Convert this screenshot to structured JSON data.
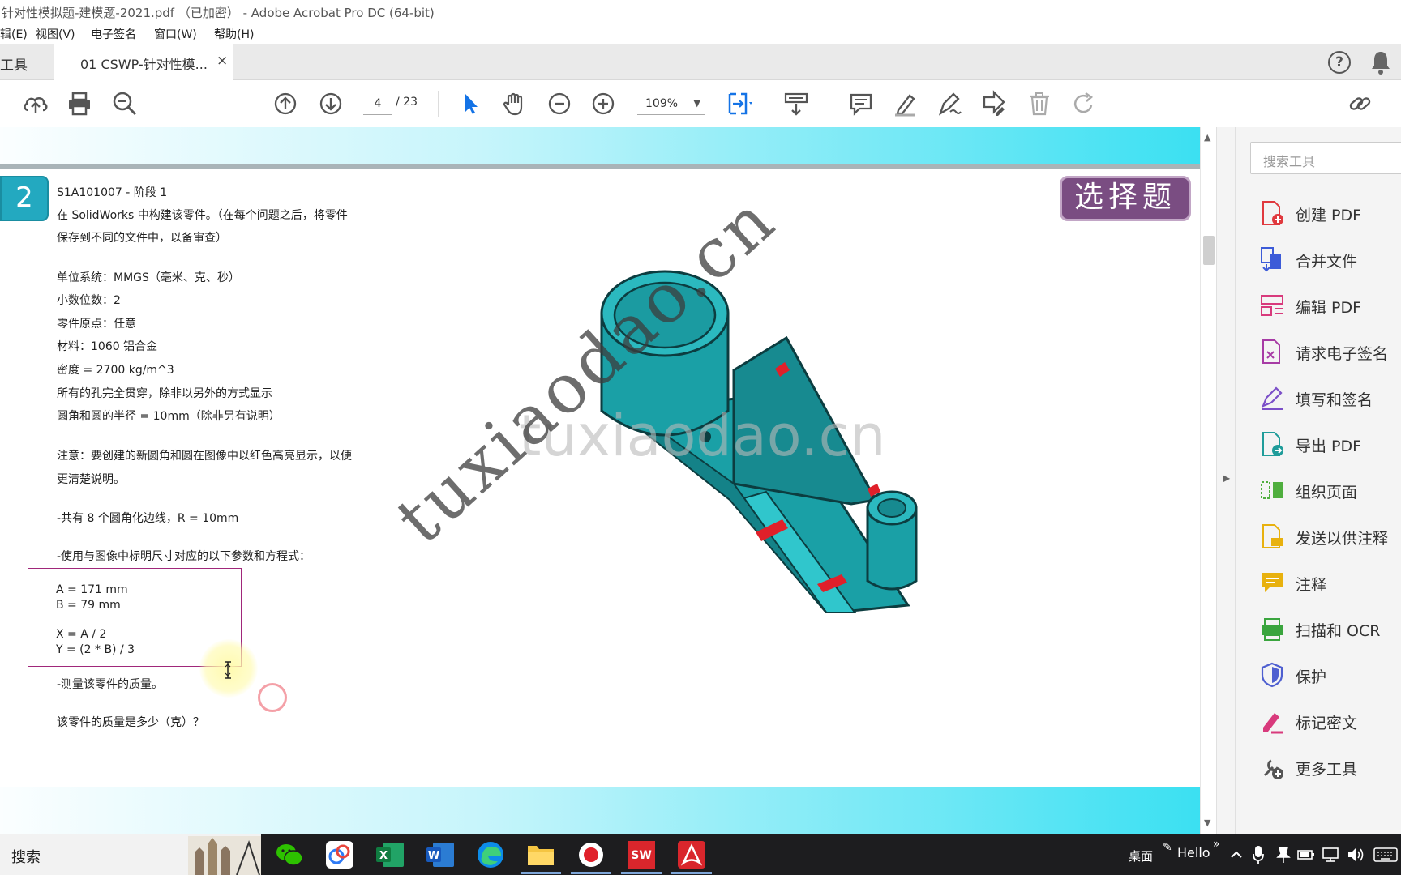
{
  "window": {
    "title": "针对性模拟题-建模题-2021.pdf （已加密） - Adobe Acrobat Pro DC (64-bit)"
  },
  "menu": [
    {
      "id": "edit",
      "label": "辑(E)"
    },
    {
      "id": "view",
      "label": "视图(V)"
    },
    {
      "id": "esign",
      "label": "电子签名"
    },
    {
      "id": "window",
      "label": "窗口(W)"
    },
    {
      "id": "help",
      "label": "帮助(H)"
    }
  ],
  "tabs": {
    "tools": "工具",
    "document": "01 CSWP-针对性模...",
    "close": "×",
    "help": "?"
  },
  "toolbar": {
    "page_current": "4",
    "page_total": "/ 23",
    "zoom": "109%"
  },
  "document": {
    "question_number": "2",
    "badge": "选择题",
    "lines": {
      "id": "S1A101007 - 阶段 1",
      "intro1": "在 SolidWorks 中构建该零件。（在每个问题之后，将零件",
      "intro2": "保存到不同的文件中，以备审查）",
      "units": "单位系统：MMGS（毫米、克、秒）",
      "decimals": "小数位数：2",
      "origin": "零件原点：任意",
      "material": "材料：1060 铝合金",
      "density": "密度 = 2700 kg/m^3",
      "holes": "所有的孔完全贯穿，除非以另外的方式显示",
      "fillets": "圆角和圆的半径 = 10mm（除非另有说明）",
      "note1": "注意：要创建的新圆角和圆在图像中以红色高亮显示，以便",
      "note2": "更清楚说明。",
      "edges": "-共有 8 个圆角化边线，R = 10mm",
      "params_intro": "-使用与图像中标明尺寸对应的以下参数和方程式：",
      "measure": "-测量该零件的质量。",
      "question": "该零件的质量是多少（克）？"
    },
    "params": {
      "a": "A = 171 mm",
      "b": "B = 79 mm",
      "x": "X = A / 2",
      "y": "Y = (2 * B) / 3"
    },
    "watermark_horizontal": "tuxiaodao.cn",
    "watermark_diagonal": "tuxiaodao.cn"
  },
  "tool_pane": {
    "search_placeholder": "搜索工具",
    "items": [
      {
        "label": "创建 PDF",
        "color": "#e0393e"
      },
      {
        "label": "合并文件",
        "color": "#3c5bd8"
      },
      {
        "label": "编辑 PDF",
        "color": "#d83a7c"
      },
      {
        "label": "请求电子签名",
        "color": "#a73ba5"
      },
      {
        "label": "填写和签名",
        "color": "#7b4fc8"
      },
      {
        "label": "导出 PDF",
        "color": "#1f9c9a"
      },
      {
        "label": "组织页面",
        "color": "#4fae3e"
      },
      {
        "label": "发送以供注释",
        "color": "#e8b10e"
      },
      {
        "label": "注释",
        "color": "#e8b10e"
      },
      {
        "label": "扫描和 OCR",
        "color": "#3aa53e"
      },
      {
        "label": "保护",
        "color": "#4e5fd0"
      },
      {
        "label": "标记密文",
        "color": "#d83a7c"
      },
      {
        "label": "更多工具",
        "color": "#555555"
      }
    ]
  },
  "taskbar": {
    "search": "搜索",
    "desktop": "桌面",
    "hello": "Hello",
    "chevron": "»"
  }
}
